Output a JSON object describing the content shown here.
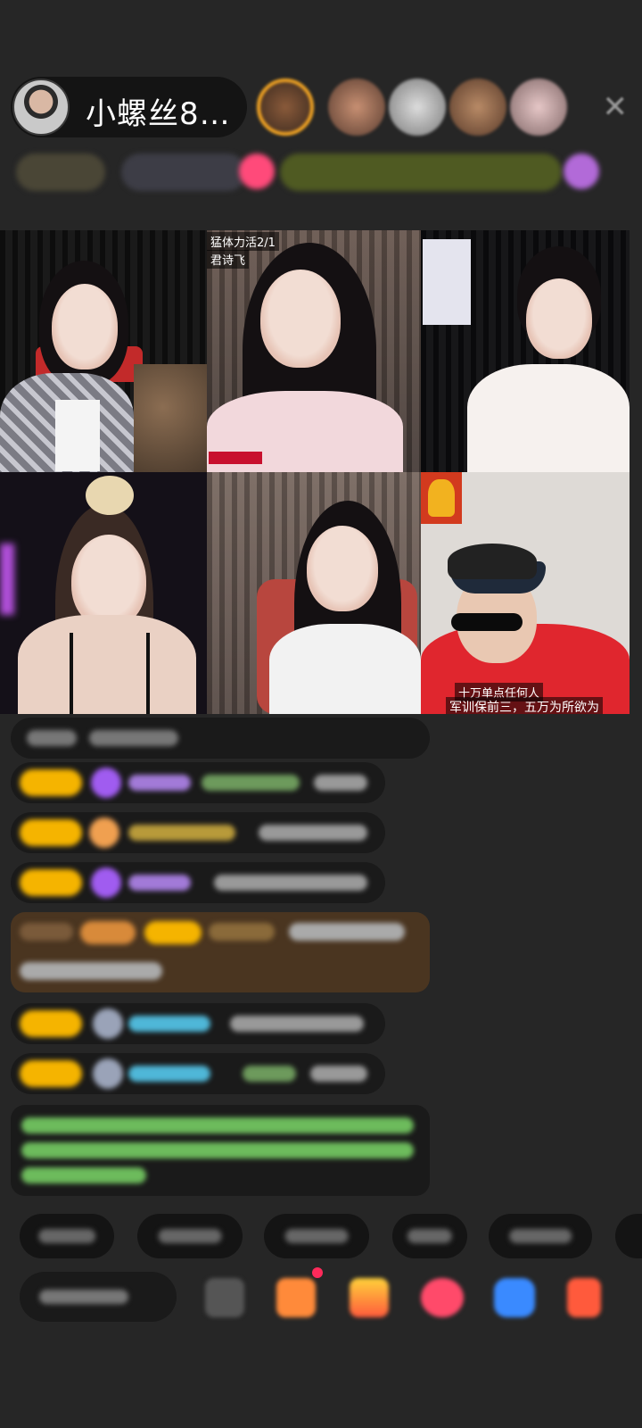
{
  "header": {
    "host_name": "小螺丝8…",
    "close_label": "✕"
  },
  "streams": [
    {
      "slot": 1,
      "captions": []
    },
    {
      "slot": 2,
      "captions": [
        "猛体力活2/1",
        "君诗飞"
      ]
    },
    {
      "slot": 3,
      "captions": []
    },
    {
      "slot": 4,
      "captions": []
    },
    {
      "slot": 5,
      "captions": []
    },
    {
      "slot": 6,
      "captions": [
        "十万单点任何人",
        "军训保前三，五万为所欲为"
      ]
    }
  ],
  "colors": {
    "background": "#262626",
    "badge_gold": "#f5b400",
    "gift_orange": "#ff5a3c",
    "chat_green": "#7dd37d",
    "chat_blue": "#4fb7d8",
    "chat_purple": "#a05cf0",
    "tile_caption_red": "#c8102e"
  },
  "icons": [
    "close-icon",
    "gem-icon",
    "gift-icon",
    "heart-icon"
  ]
}
